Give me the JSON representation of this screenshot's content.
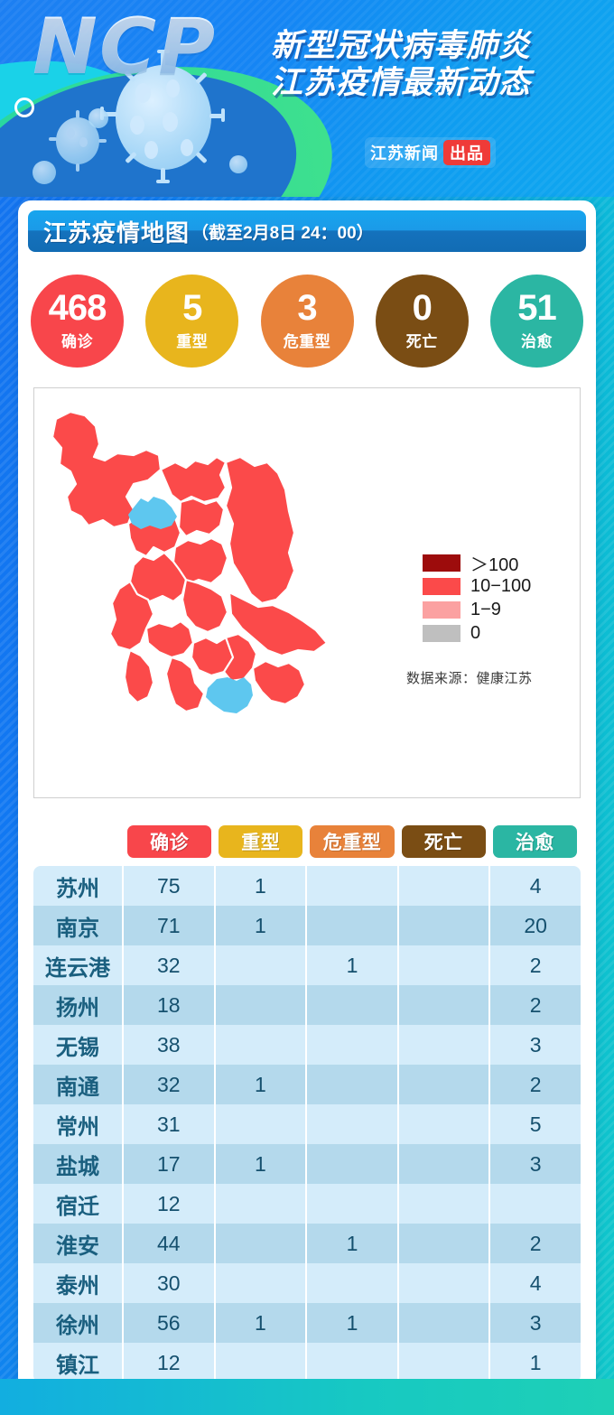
{
  "hero": {
    "logo_text": "NCP",
    "title_line1": "新型冠状病毒肺炎",
    "title_line2": "江苏疫情最新动态",
    "source_label": "江苏新闻",
    "source_tag": "出品"
  },
  "section": {
    "title": "江苏疫情地图",
    "timestamp": "（截至2月8日 24：00）"
  },
  "stats": [
    {
      "num": "468",
      "label": "确诊",
      "color": "#f8464b"
    },
    {
      "num": "5",
      "label": "重型",
      "color": "#e8b51d"
    },
    {
      "num": "3",
      "label": "危重型",
      "color": "#e8823a"
    },
    {
      "num": "0",
      "label": "死亡",
      "color": "#7a4d14"
    },
    {
      "num": "51",
      "label": "治愈",
      "color": "#2bb6a3"
    }
  ],
  "map": {
    "legend": [
      {
        "label": "＞100",
        "color": "#9d0c0c"
      },
      {
        "label": "10−100",
        "color": "#fb4a4a"
      },
      {
        "label": "1−9",
        "color": "#fba1a1"
      },
      {
        "label": "0",
        "color": "#bfbfbf"
      }
    ],
    "source": "数据来源：健康江苏",
    "region_color": "#fb4a4a",
    "border_color": "#ffffff",
    "lake_color": "#5ec7ef"
  },
  "chart_data": {
    "type": "table",
    "title": "江苏疫情地图（截至2月8日 24：00）",
    "columns": [
      "",
      "确诊",
      "重型",
      "危重型",
      "死亡",
      "治愈"
    ],
    "column_colors": [
      "",
      "#f8464b",
      "#e8b51d",
      "#e8823a",
      "#7a4d14",
      "#2bb6a3"
    ],
    "rows": [
      {
        "city": "苏州",
        "confirmed": "75",
        "severe": "1",
        "critical": "",
        "deaths": "",
        "cured": "4"
      },
      {
        "city": "南京",
        "confirmed": "71",
        "severe": "1",
        "critical": "",
        "deaths": "",
        "cured": "20"
      },
      {
        "city": "连云港",
        "confirmed": "32",
        "severe": "",
        "critical": "1",
        "deaths": "",
        "cured": "2"
      },
      {
        "city": "扬州",
        "confirmed": "18",
        "severe": "",
        "critical": "",
        "deaths": "",
        "cured": "2"
      },
      {
        "city": "无锡",
        "confirmed": "38",
        "severe": "",
        "critical": "",
        "deaths": "",
        "cured": "3"
      },
      {
        "city": "南通",
        "confirmed": "32",
        "severe": "1",
        "critical": "",
        "deaths": "",
        "cured": "2"
      },
      {
        "city": "常州",
        "confirmed": "31",
        "severe": "",
        "critical": "",
        "deaths": "",
        "cured": "5"
      },
      {
        "city": "盐城",
        "confirmed": "17",
        "severe": "1",
        "critical": "",
        "deaths": "",
        "cured": "3"
      },
      {
        "city": "宿迁",
        "confirmed": "12",
        "severe": "",
        "critical": "",
        "deaths": "",
        "cured": ""
      },
      {
        "city": "淮安",
        "confirmed": "44",
        "severe": "",
        "critical": "1",
        "deaths": "",
        "cured": "2"
      },
      {
        "city": "泰州",
        "confirmed": "30",
        "severe": "",
        "critical": "",
        "deaths": "",
        "cured": "4"
      },
      {
        "city": "徐州",
        "confirmed": "56",
        "severe": "1",
        "critical": "1",
        "deaths": "",
        "cured": "3"
      },
      {
        "city": "镇江",
        "confirmed": "12",
        "severe": "",
        "critical": "",
        "deaths": "",
        "cured": "1"
      }
    ],
    "totals": {
      "confirmed": 468,
      "severe": 5,
      "critical": 3,
      "deaths": 0,
      "cured": 51
    }
  }
}
